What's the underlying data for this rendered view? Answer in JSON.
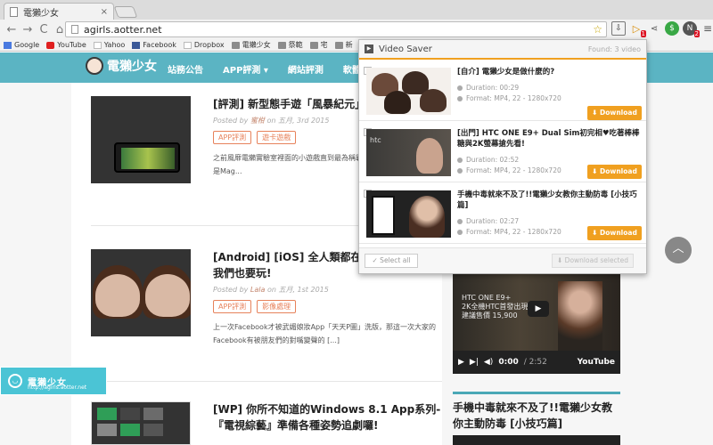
{
  "browser": {
    "tab_title": "電獺少女",
    "tab_close": "×",
    "url": "agirls.aotter.net",
    "nav": {
      "back": "←",
      "forward": "→",
      "reload": "C",
      "home": "⌂"
    },
    "star": "☆",
    "ext_badge": "1",
    "ext_n_badge": "2",
    "bookmarks": [
      "Google",
      "YouTube",
      "Yahoo",
      "Facebook",
      "Dropbox",
      "電獺少女",
      "祭範",
      "宅",
      "新"
    ]
  },
  "site": {
    "logo_text": "電獺少女",
    "nav_items": [
      "站務公告",
      "APP評測",
      "網站評測",
      "軟體評測"
    ],
    "nav_app_caret": "▾",
    "float_logo": {
      "icon": "◡",
      "name": "電獺少女",
      "url": "http://agirls.aotter.net"
    },
    "scroll_top": "︿"
  },
  "posts": [
    {
      "title": "[評測] 新型態手遊「風暴紀元」搶先玩!!",
      "meta_prefix": "Posted by ",
      "author": "蜜柑",
      "meta_suffix": " on 五月, 3rd 2015",
      "tags": [
        "APP評測",
        "遊卡遊戲"
      ],
      "excerpt": "之前風靡電獺實驗室裡面的小遊戲直到最為稱霸的獺獺們形成諸多高牆，像是Mag..."
    },
    {
      "title": "[Android] [iOS] 全人類都在玩的對嘴短片App我們也要玩!",
      "meta_prefix": "Posted by ",
      "author": "Lala",
      "meta_suffix": " on 五月, 1st 2015",
      "tags": [
        "APP評測",
        "影像處理"
      ],
      "excerpt": "上一次Facebook才被武媚娘妝App「天天P圖」洗版，那這一次大家的Facebook有被朋友們的對嘴變聲的 [...]"
    },
    {
      "title": "[WP] 你所不知道的Windows 8.1 App系列-『電視綜藝』準備各種姿勢追劇囉!"
    }
  ],
  "sidebar": {
    "video": {
      "line1": "HTC ONE E9+",
      "line2": "2K全機HTC首發出現",
      "line3": "建議售價 15,900",
      "play": "▶",
      "time": "0:00",
      "duration": "/ 2:52",
      "yt": "YouTube"
    },
    "title": "手機中毒就來不及了!!電獺少女教你主動防毒 [小技巧篇]"
  },
  "popup": {
    "logo": "▶",
    "title": "Video Saver",
    "found": "Found: 3 video",
    "duration_label": "Duration: ",
    "format_label": "Format: ",
    "download_label": "⬇ Download",
    "videos": [
      {
        "title": "[自介] 電獺少女是做什麼的?",
        "duration": "00:29",
        "format": "MP4, 22 - 1280x720"
      },
      {
        "title": "[出門] HTC ONE E9+ Dual Sim初完相♥吃著棒棒糖與2K螢幕搶先看!",
        "duration": "02:52",
        "format": "MP4, 22 - 1280x720"
      },
      {
        "title": "手機中毒就來不及了!!電獺少女教你主動防毒 [小技巧篇]",
        "duration": "02:27",
        "format": "MP4, 22 - 1280x720"
      }
    ],
    "select_all": "✓ Select all",
    "download_selected": "⬇ Download selected"
  }
}
